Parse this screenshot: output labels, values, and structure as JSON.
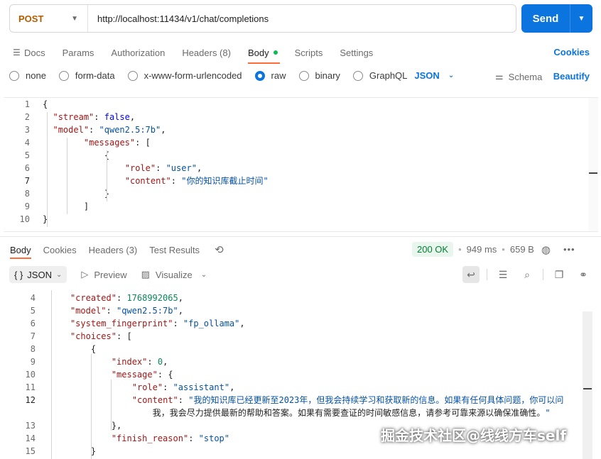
{
  "request": {
    "method": "POST",
    "url": "http://localhost:11434/v1/chat/completions",
    "send_label": "Send"
  },
  "req_tabs": [
    {
      "label": "Docs"
    },
    {
      "label": "Params"
    },
    {
      "label": "Authorization"
    },
    {
      "label": "Headers (8)"
    },
    {
      "label": "Body"
    },
    {
      "label": "Scripts"
    },
    {
      "label": "Settings"
    }
  ],
  "cookies_label": "Cookies",
  "body_types": [
    "none",
    "form-data",
    "x-www-form-urlencoded",
    "raw",
    "binary",
    "GraphQL"
  ],
  "body_type_selected": "raw",
  "body_format": "JSON",
  "schema_label": "Schema",
  "beautify_label": "Beautify",
  "request_body_lines": [
    {
      "n": "1",
      "text": "{"
    },
    {
      "n": "2",
      "text": "  \"stream\": false,"
    },
    {
      "n": "3",
      "text": "  \"model\": \"qwen2.5:7b\","
    },
    {
      "n": "4",
      "text": "        \"messages\": ["
    },
    {
      "n": "5",
      "text": "            {"
    },
    {
      "n": "6",
      "text": "                \"role\": \"user\","
    },
    {
      "n": "7",
      "text": "                \"content\": \"你的知识库截止时间\""
    },
    {
      "n": "8",
      "text": "            }"
    },
    {
      "n": "9",
      "text": "        ]"
    },
    {
      "n": "10",
      "text": "}"
    }
  ],
  "response": {
    "tabs": [
      "Body",
      "Cookies",
      "Headers (3)",
      "Test Results"
    ],
    "status": "200 OK",
    "time": "949 ms",
    "size": "659 B",
    "format": "JSON",
    "preview_label": "Preview",
    "visualize_label": "Visualize"
  },
  "response_body_lines": [
    {
      "n": "4",
      "text": "    \"created\": 1768992065,"
    },
    {
      "n": "5",
      "text": "    \"model\": \"qwen2.5:7b\","
    },
    {
      "n": "6",
      "text": "    \"system_fingerprint\": \"fp_ollama\","
    },
    {
      "n": "7",
      "text": "    \"choices\": ["
    },
    {
      "n": "8",
      "text": "        {"
    },
    {
      "n": "9",
      "text": "            \"index\": 0,"
    },
    {
      "n": "10",
      "text": "            \"message\": {"
    },
    {
      "n": "11",
      "text": "                \"role\": \"assistant\","
    },
    {
      "n": "12",
      "text": "                \"content\": \"我的知识库已经更新至2023年，但我会持续学习和获取新的信息。如果有任何具体问题，你可以问"
    },
    {
      "n": "",
      "text": "                    我，我会尽力提供最新的帮助和答案。如果有需要查证的时间敏感信息，请参考可靠来源以确保准确性。\""
    },
    {
      "n": "13",
      "text": "            },"
    },
    {
      "n": "14",
      "text": "            \"finish_reason\": \"stop\""
    },
    {
      "n": "15",
      "text": "        }"
    }
  ],
  "watermark": "掘金技术社区@线线方车self"
}
